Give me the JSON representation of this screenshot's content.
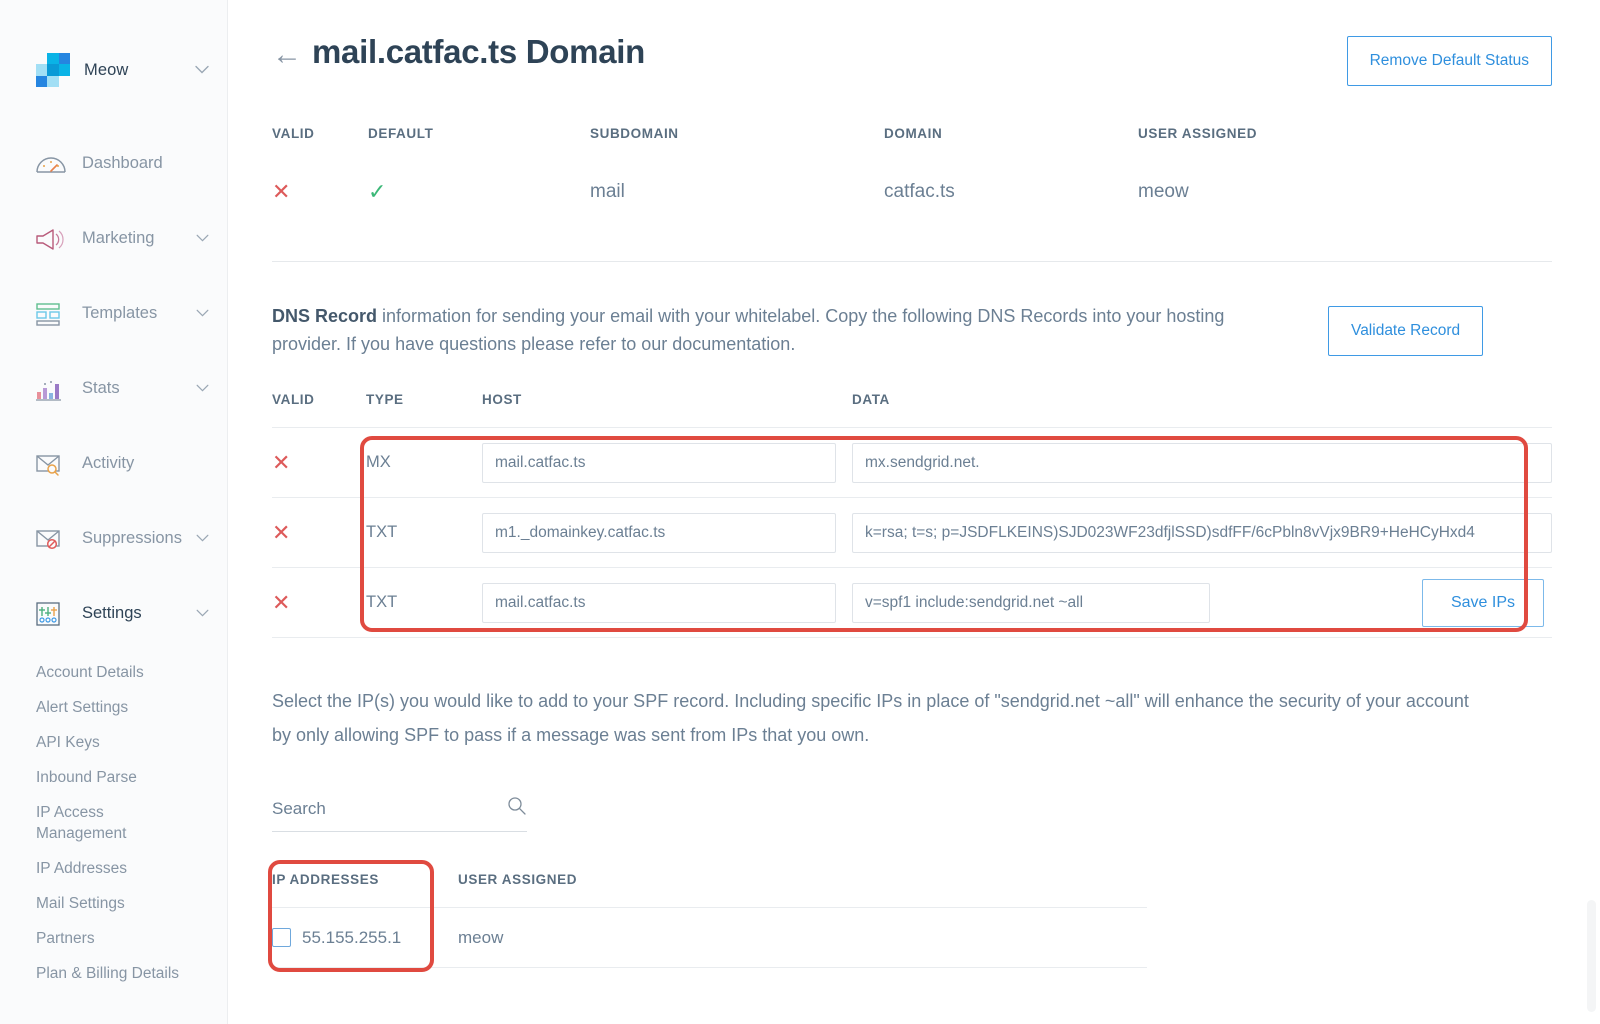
{
  "sidebar": {
    "brand": {
      "name": "Meow",
      "chevron": "chevron-down-icon"
    },
    "nav": [
      {
        "label": "Dashboard",
        "icon": "gauge-icon",
        "chevron": false,
        "active": false
      },
      {
        "label": "Marketing",
        "icon": "megaphone-icon",
        "chevron": true,
        "active": false
      },
      {
        "label": "Templates",
        "icon": "templates-icon",
        "chevron": true,
        "active": false
      },
      {
        "label": "Stats",
        "icon": "bar-chart-icon",
        "chevron": true,
        "active": false
      },
      {
        "label": "Activity",
        "icon": "envelope-search-icon",
        "chevron": false,
        "active": false
      },
      {
        "label": "Suppressions",
        "icon": "envelope-blocked-icon",
        "chevron": true,
        "active": false
      },
      {
        "label": "Settings",
        "icon": "sliders-icon",
        "chevron": true,
        "active": true
      }
    ],
    "settings_sub": [
      "Account Details",
      "Alert Settings",
      "API Keys",
      "Inbound Parse",
      "IP Access Management",
      "IP Addresses",
      "Mail Settings",
      "Partners",
      "Plan & Billing Details"
    ]
  },
  "header": {
    "back_arrow": "←",
    "title": "mail.catfac.ts Domain",
    "remove_default_label": "Remove Default Status"
  },
  "summary": {
    "columns": [
      "VALID",
      "DEFAULT",
      "SUBDOMAIN",
      "DOMAIN",
      "USER ASSIGNED"
    ],
    "valid": "✕",
    "default": "✓",
    "subdomain": "mail",
    "domain": "catfac.ts",
    "user_assigned": "meow"
  },
  "dns": {
    "lead_bold": "DNS Record",
    "lead_rest": " information for sending your email with your whitelabel. Copy the following DNS Records into your hosting provider. If you have questions please refer to our documentation.",
    "validate_label": "Validate Record",
    "columns": [
      "VALID",
      "TYPE",
      "HOST",
      "DATA"
    ],
    "rows": [
      {
        "valid": "✕",
        "type": "MX",
        "host": "mail.catfac.ts",
        "data": "mx.sendgrid.net."
      },
      {
        "valid": "✕",
        "type": "TXT",
        "host": "m1._domainkey.catfac.ts",
        "data": "k=rsa; t=s; p=JSDFLKEINS)SJD023WF23dfjlSSD)sdfFF/6cPbln8vVjx9BR9+HeHCyHxd4"
      },
      {
        "valid": "✕",
        "type": "TXT",
        "host": "mail.catfac.ts",
        "data": "v=spf1 include:sendgrid.net ~all"
      }
    ],
    "save_ips_label": "Save IPs"
  },
  "spf": {
    "text": "Select the IP(s) you would like to add to your SPF record. Including specific IPs in place of \"sendgrid.net ~all\" will enhance the security of your account by only allowing SPF to pass if a message was sent from IPs that you own."
  },
  "search": {
    "placeholder": "Search",
    "value": "",
    "icon": "search-icon"
  },
  "ip_table": {
    "columns": [
      "IP ADDRESSES",
      "USER ASSIGNED"
    ],
    "rows": [
      {
        "checked": false,
        "ip": "55.155.255.1",
        "user": "meow"
      }
    ]
  },
  "colors": {
    "accent_blue": "#2f8fdd",
    "title_navy": "#2e4356",
    "body_slate": "#6b7f93",
    "error_red": "#dd5a5a",
    "success_green": "#3cb878",
    "highlight_red": "#e04a40",
    "sidebar_bg": "#fafbfc"
  }
}
